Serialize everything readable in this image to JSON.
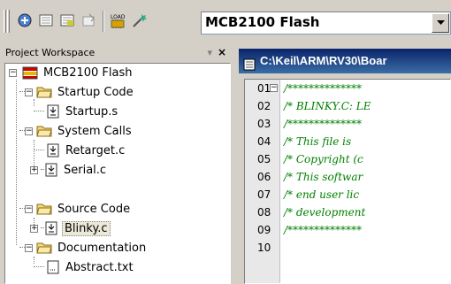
{
  "toolbar": {
    "target_value": "MCB2100 Flash",
    "buttons": [
      "translate-icon",
      "build-icon",
      "rebuild-icon",
      "stop-build-icon",
      "download-icon",
      "options-icon"
    ]
  },
  "workspace": {
    "title": "Project Workspace",
    "tree": {
      "root": "MCB2100 Flash",
      "groups": [
        {
          "label": "Startup Code",
          "files": [
            "Startup.s"
          ]
        },
        {
          "label": "System Calls",
          "files": [
            "Retarget.c",
            "Serial.c"
          ]
        },
        {
          "label": "Source Code",
          "files": [
            "Blinky.c"
          ]
        },
        {
          "label": "Documentation",
          "files": [
            "Abstract.txt"
          ]
        }
      ]
    }
  },
  "editor": {
    "title": "C:\\Keil\\ARM\\RV30\\Boar",
    "lines": [
      {
        "num": "01",
        "text": "/**************"
      },
      {
        "num": "02",
        "text": "/* BLINKY.C: LE"
      },
      {
        "num": "03",
        "text": "/**************"
      },
      {
        "num": "04",
        "text": "/* This file is"
      },
      {
        "num": "05",
        "text": "/* Copyright (c"
      },
      {
        "num": "06",
        "text": "/* This softwar"
      },
      {
        "num": "07",
        "text": "/* end user lic"
      },
      {
        "num": "08",
        "text": "/* development "
      },
      {
        "num": "09",
        "text": "/**************"
      },
      {
        "num": "10",
        "text": ""
      }
    ]
  },
  "colors": {
    "code_comment": "#008000",
    "title_bar": "#0a246a",
    "chrome": "#d4d0c8"
  }
}
